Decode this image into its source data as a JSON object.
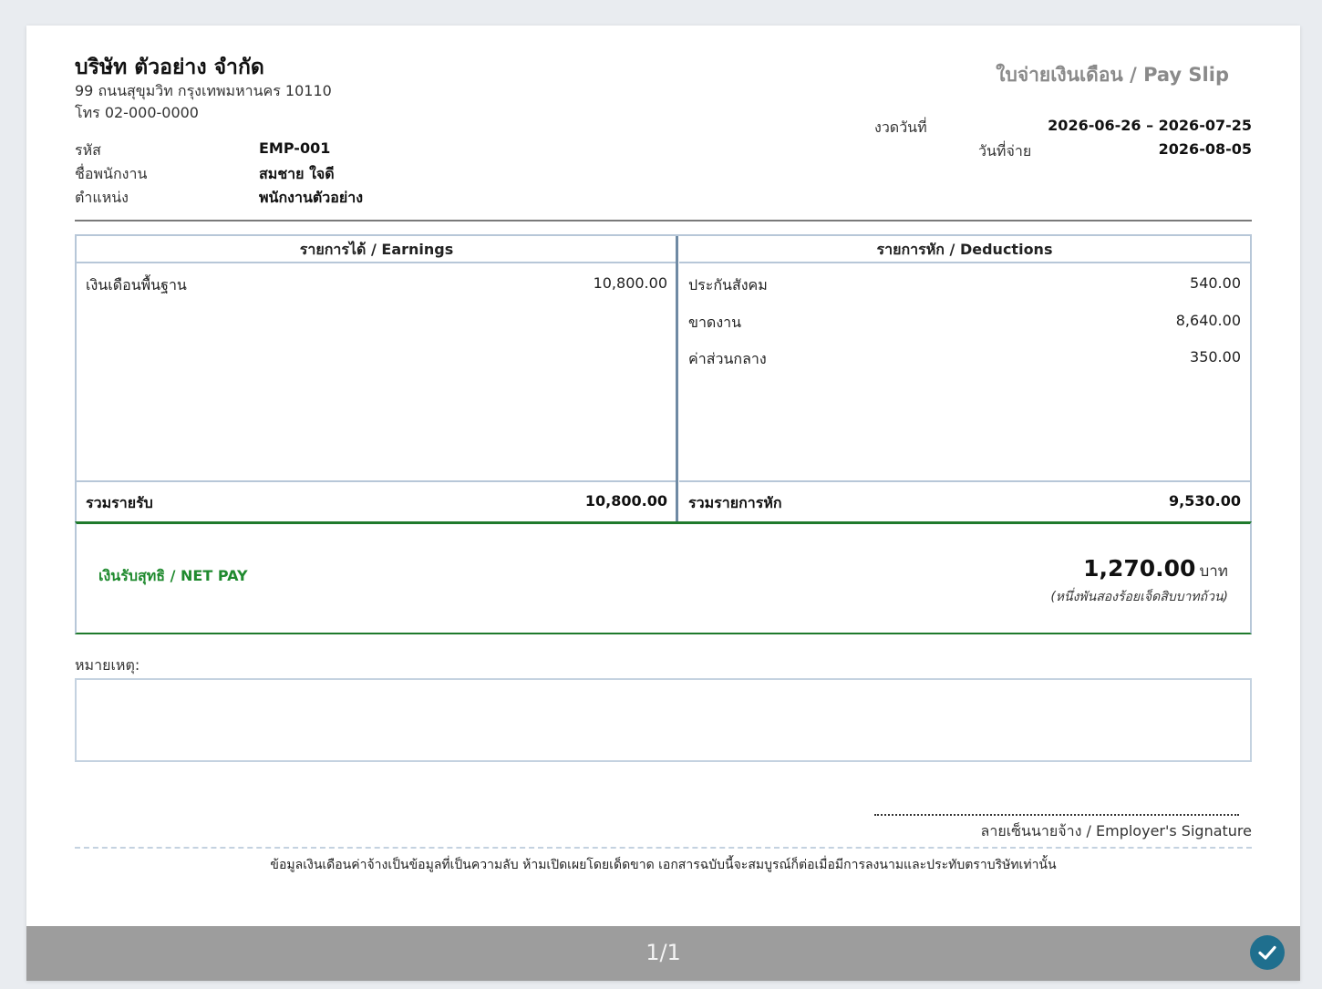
{
  "company": {
    "name": "บริษัท ตัวอย่าง จำกัด",
    "address": "99 ถนนสุขุมวิท กรุงเทพมหานคร 10110",
    "phone": "โทร 02-000-0000"
  },
  "document_title": "ใบจ่ายเงินเดือน / Pay Slip",
  "period": {
    "label": "งวดวันที่",
    "value": "2026-06-26 – 2026-07-25"
  },
  "pay_date": {
    "label": "วันที่จ่าย",
    "value": "2026-08-05"
  },
  "employee": {
    "id_label": "รหัส",
    "id": "EMP-001",
    "name_label": "ชื่อพนักงาน",
    "name": "สมชาย ใจดี",
    "position_label": "ตำแหน่ง",
    "position": "พนักงานตัวอย่าง"
  },
  "earnings": {
    "header": "รายการได้ / Earnings",
    "items": [
      {
        "label": "เงินเดือนพื้นฐาน",
        "amount": "10,800.00"
      }
    ],
    "total_label": "รวมรายรับ",
    "total": "10,800.00"
  },
  "deductions": {
    "header": "รายการหัก / Deductions",
    "items": [
      {
        "label": "ประกันสังคม",
        "amount": "540.00"
      },
      {
        "label": "ขาดงาน",
        "amount": "8,640.00"
      },
      {
        "label": "ค่าส่วนกลาง",
        "amount": "350.00"
      }
    ],
    "total_label": "รวมรายการหัก",
    "total": "9,530.00"
  },
  "net_pay": {
    "label": "เงินรับสุทธิ / NET PAY",
    "amount": "1,270.00",
    "currency": "บาท",
    "in_words": "(หนึ่งพันสองร้อยเจ็ดสิบบาทถ้วน)"
  },
  "remarks": {
    "label": "หมายเหตุ:",
    "value": ""
  },
  "signature_label": "ลายเซ็นนายจ้าง / Employer's Signature",
  "footer_note": "ข้อมูลเงินเดือนค่าจ้างเป็นข้อมูลที่เป็นความลับ ห้ามเปิดเผยโดยเด็ดขาด เอกสารฉบับนี้จะสมบูรณ์ก็ต่อเมื่อมีการลงนามและประทับตราบริษัทเท่านั้น",
  "viewer": {
    "page_indicator": "1/1",
    "confirm_icon": "check-circle-icon"
  },
  "colors": {
    "net_pay_green": "#1f8a2e",
    "table_border": "#b7c7d8",
    "confirm_button": "#1f6f8e"
  }
}
